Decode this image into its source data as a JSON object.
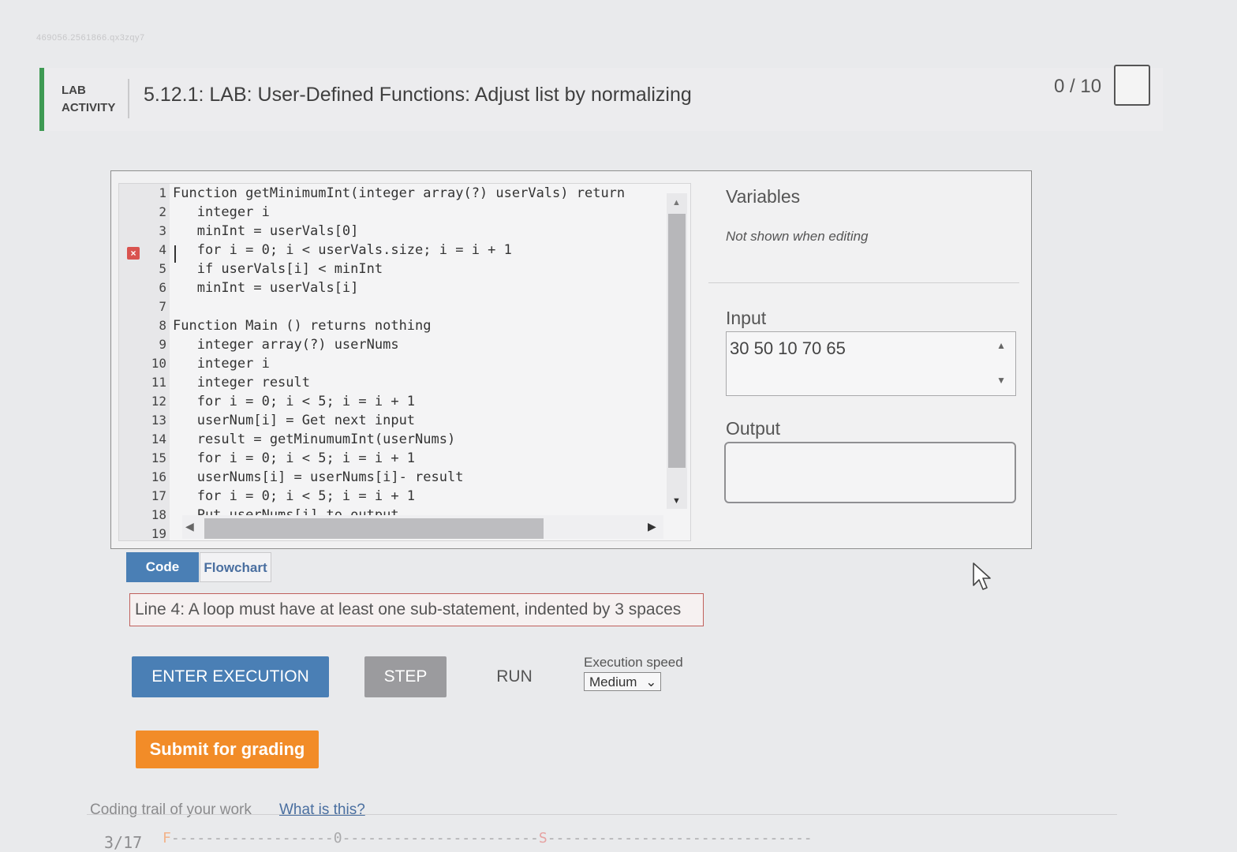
{
  "page_id": "469056.2561866.qx3zqy7",
  "header": {
    "lab_label_line1": "LAB",
    "lab_label_line2": "ACTIVITY",
    "title": "5.12.1: LAB: User-Defined Functions: Adjust list by normalizing",
    "score": "0 / 10"
  },
  "editor": {
    "line_numbers": [
      "1",
      "2",
      "3",
      "4",
      "5",
      "6",
      "7",
      "8",
      "9",
      "10",
      "11",
      "12",
      "13",
      "14",
      "15",
      "16",
      "17",
      "18",
      "19"
    ],
    "lines": [
      "Function getMinimumInt(integer array(?) userVals) return",
      "   integer i",
      "   minInt = userVals[0]",
      "   for i = 0; i < userVals.size; i = i + 1",
      "   if userVals[i] < minInt",
      "   minInt = userVals[i]",
      "",
      "Function Main () returns nothing",
      "   integer array(?) userNums",
      "   integer i",
      "   integer result",
      "   for i = 0; i < 5; i = i + 1",
      "   userNum[i] = Get next input",
      "   result = getMinumumInt(userNums)",
      "   for i = 0; i < 5; i = i + 1",
      "   userNums[i] = userNums[i]- result",
      "   for i = 0; i < 5; i = i + 1",
      "   Put userNums[i] to output",
      ""
    ],
    "error_line": "4",
    "error_marker": "×"
  },
  "variables": {
    "title": "Variables",
    "note": "Not shown when editing"
  },
  "input": {
    "title": "Input",
    "value": "30 50 10 70 65"
  },
  "output": {
    "title": "Output",
    "value": ""
  },
  "tabs": {
    "code": "Code",
    "flowchart": "Flowchart"
  },
  "error_message": "Line 4: A loop must have at least one sub-statement, indented by 3 spaces",
  "controls": {
    "enter_execution": "ENTER EXECUTION",
    "step": "STEP",
    "run": "RUN",
    "speed_label": "Execution speed",
    "speed_value": "Medium"
  },
  "submit_label": "Submit for grading",
  "trail": {
    "label": "Coding trail of your work",
    "link": "What is this?",
    "count": "3/17",
    "progress_f": "F",
    "progress_mid": "-------------------0-----------------------",
    "progress_s": "S",
    "progress_end": "-------------------------------"
  },
  "colors": {
    "accent_blue": "#4a7fb5",
    "submit_orange": "#f28c28",
    "lab_green": "#3e9a53",
    "error_red": "#d9534f"
  }
}
